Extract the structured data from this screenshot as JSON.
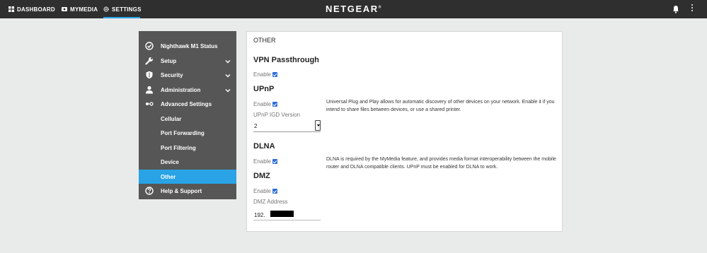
{
  "topbar": {
    "nav": [
      {
        "label": "DASHBOARD",
        "icon": "grid-icon"
      },
      {
        "label": "MYMEDIA",
        "icon": "media-icon"
      },
      {
        "label": "SETTINGS",
        "icon": "gear-icon",
        "active": true
      }
    ],
    "brand": "NETGEAR",
    "brand_mark": "®",
    "accent_color": "#2aa3e8"
  },
  "sidebar": {
    "items": [
      {
        "label": "Nighthawk M1 Status",
        "icon": "check-circle-icon"
      },
      {
        "label": "Setup",
        "icon": "wrench-icon",
        "expandable": true
      },
      {
        "label": "Security",
        "icon": "shield-icon",
        "expandable": true
      },
      {
        "label": "Administration",
        "icon": "person-icon",
        "expandable": true
      },
      {
        "label": "Advanced Settings",
        "icon": "nodes-icon"
      },
      {
        "label": "Cellular"
      },
      {
        "label": "Port Forwarding"
      },
      {
        "label": "Port Filtering"
      },
      {
        "label": "Device"
      },
      {
        "label": "Other",
        "active": true
      },
      {
        "label": "Help & Support",
        "icon": "help-icon"
      }
    ],
    "active_color": "#29a3e5"
  },
  "main": {
    "title": "OTHER",
    "vpn": {
      "heading": "VPN Passthrough",
      "enable_label": "Enable",
      "checked": true
    },
    "upnp": {
      "heading": "UPnP",
      "enable_label": "Enable",
      "checked": true,
      "description": "Universal Plug and Play allows for automatic discovery of other devices on your network. Enable it if you intend to share files between devices, or use a shared printer.",
      "igd_label": "UPnP IGD Version",
      "igd_value": "2"
    },
    "dlna": {
      "heading": "DLNA",
      "enable_label": "Enable",
      "checked": true,
      "description": "DLNA is required by the MyMedia feature, and provides media format interoperability between the mobile router and DLNA compatible clients. UPnP must be enabled for DLNA to work."
    },
    "dmz": {
      "heading": "DMZ",
      "enable_label": "Enable",
      "checked": true,
      "address_label": "DMZ Address",
      "address_value": "192."
    }
  }
}
